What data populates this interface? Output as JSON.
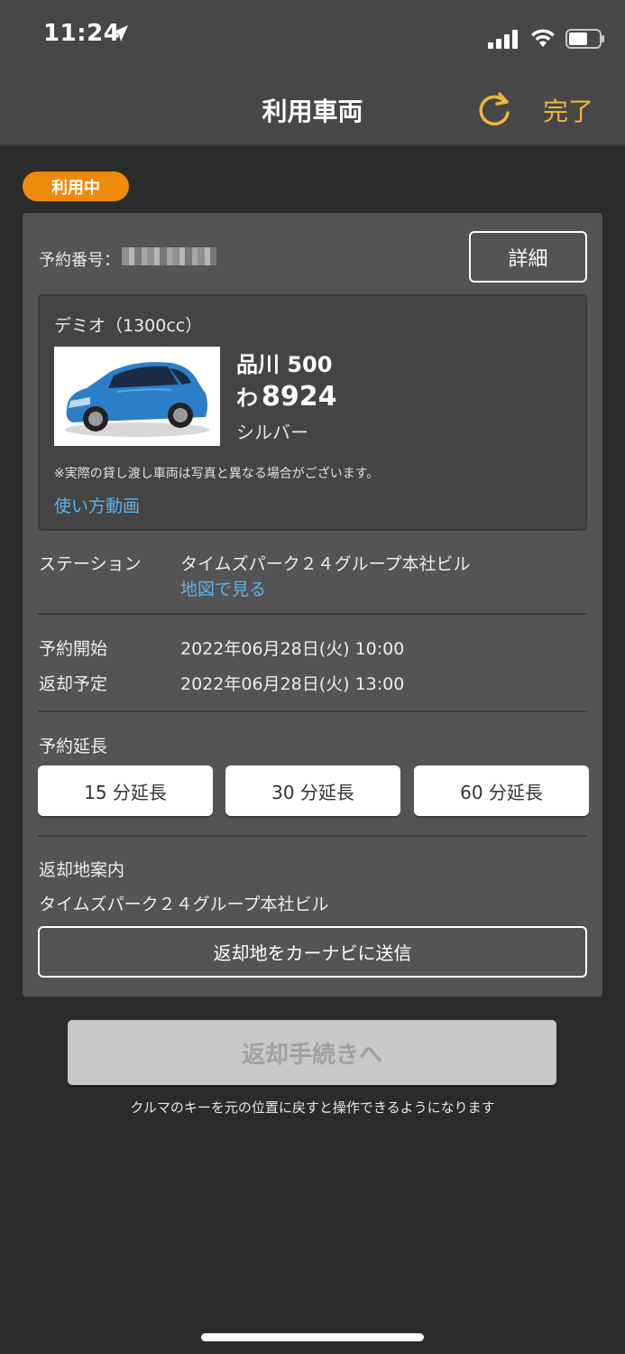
{
  "status_bar": {
    "time": "11:24"
  },
  "header": {
    "title": "利用車両",
    "done_label": "完了"
  },
  "badge": "利用中",
  "reservation": {
    "label": "予約番号：",
    "detail_label": "詳細"
  },
  "vehicle": {
    "model": "デミオ（1300cc）",
    "plate_line1": "品川 500",
    "plate_kana": "わ",
    "plate_number": "8924",
    "color": "シルバー",
    "note": "※実際の貸し渡し車両は写真と異なる場合がございます。",
    "video_link": "使い方動画"
  },
  "station": {
    "label": "ステーション",
    "value": "タイムズパーク２４グループ本社ビル",
    "map_link": "地図で見る"
  },
  "schedule": {
    "start_label": "予約開始",
    "start_value": "2022年06月28日(火) 10:00",
    "return_label": "返却予定",
    "return_value": "2022年06月28日(火) 13:00"
  },
  "extension": {
    "label": "予約延長",
    "options": [
      "15 分延長",
      "30 分延長",
      "60 分延長"
    ]
  },
  "return_guide": {
    "label": "返却地案内",
    "location": "タイムズパーク２４グループ本社ビル",
    "navi_button": "返却地をカーナビに送信"
  },
  "return_button": "返却手続きへ",
  "return_note": "クルマのキーを元の位置に戻すと操作できるようになります",
  "colors": {
    "accent": "#f0b43c",
    "badge": "#ef8a0b",
    "link": "#5fb3ea",
    "car": "#2a7fc8"
  }
}
